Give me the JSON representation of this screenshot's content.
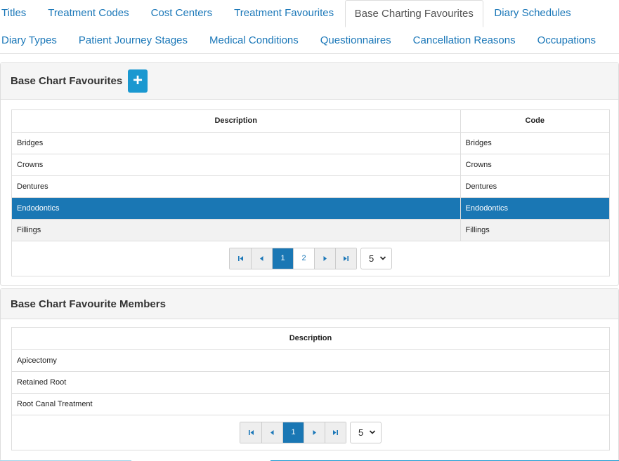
{
  "tabs": {
    "row1": [
      "Titles",
      "Treatment Codes",
      "Cost Centers",
      "Treatment Favourites",
      "Base Charting Favourites",
      "Diary Schedules"
    ],
    "row2": [
      "Diary Types",
      "Patient Journey Stages",
      "Medical Conditions",
      "Questionnaires",
      "Cancellation Reasons",
      "Occupations"
    ],
    "active": "Base Charting Favourites"
  },
  "favourites": {
    "title": "Base Chart Favourites",
    "add_label": "+",
    "columns": [
      "Description",
      "Code"
    ],
    "rows": [
      {
        "description": "Bridges",
        "code": "Bridges"
      },
      {
        "description": "Crowns",
        "code": "Crowns"
      },
      {
        "description": "Dentures",
        "code": "Dentures"
      },
      {
        "description": "Endodontics",
        "code": "Endodontics"
      },
      {
        "description": "Fillings",
        "code": "Fillings"
      }
    ],
    "selected_row": 3,
    "pager": {
      "pages": [
        "1",
        "2"
      ],
      "current": "1",
      "page_size": "5"
    }
  },
  "members": {
    "title": "Base Chart Favourite Members",
    "columns": [
      "Description"
    ],
    "rows": [
      {
        "description": "Apicectomy"
      },
      {
        "description": "Retained Root"
      },
      {
        "description": "Root Canal Treatment"
      }
    ],
    "pager": {
      "pages": [
        "1"
      ],
      "current": "1",
      "page_size": "5"
    }
  },
  "colors": {
    "accent": "#1a77b4",
    "link": "#1a77b8",
    "add_button": "#1a98d0"
  },
  "icons": [
    "plus-icon",
    "first-page-icon",
    "prev-page-icon",
    "next-page-icon",
    "last-page-icon",
    "chevron-down-icon"
  ]
}
